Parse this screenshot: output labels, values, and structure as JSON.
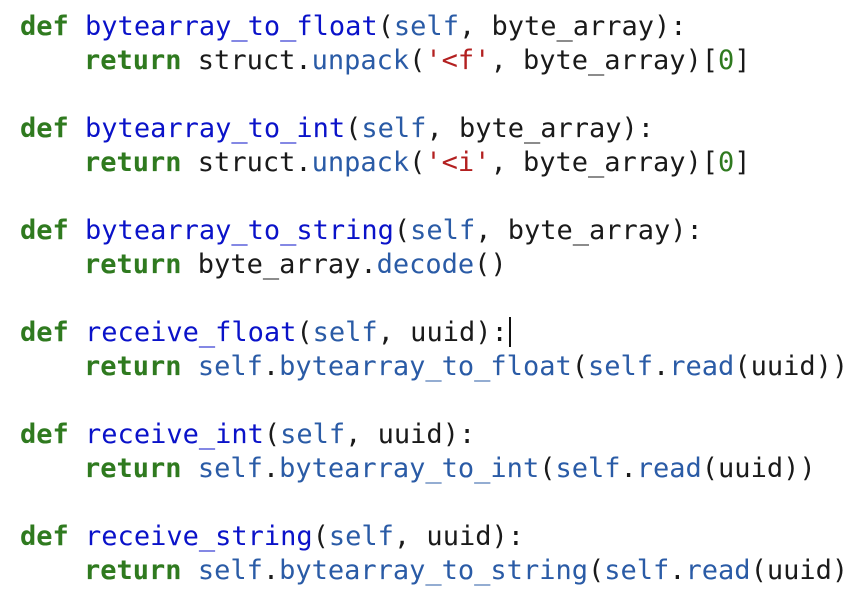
{
  "code": {
    "lines": [
      [
        {
          "t": "def",
          "c": "kw"
        },
        {
          "t": " ",
          "c": "plain"
        },
        {
          "t": "bytearray_to_float",
          "c": "fn"
        },
        {
          "t": "(",
          "c": "plain"
        },
        {
          "t": "self",
          "c": "self"
        },
        {
          "t": ", byte_array):",
          "c": "plain"
        }
      ],
      [
        {
          "t": "return",
          "c": "kw"
        },
        {
          "t": " struct.",
          "c": "plain"
        },
        {
          "t": "unpack",
          "c": "meth"
        },
        {
          "t": "(",
          "c": "plain"
        },
        {
          "t": "'<f'",
          "c": "str"
        },
        {
          "t": ", byte_array)[",
          "c": "plain"
        },
        {
          "t": "0",
          "c": "num"
        },
        {
          "t": "]",
          "c": "plain"
        }
      ],
      [],
      [
        {
          "t": "def",
          "c": "kw"
        },
        {
          "t": " ",
          "c": "plain"
        },
        {
          "t": "bytearray_to_int",
          "c": "fn"
        },
        {
          "t": "(",
          "c": "plain"
        },
        {
          "t": "self",
          "c": "self"
        },
        {
          "t": ", byte_array):",
          "c": "plain"
        }
      ],
      [
        {
          "t": "return",
          "c": "kw"
        },
        {
          "t": " struct.",
          "c": "plain"
        },
        {
          "t": "unpack",
          "c": "meth"
        },
        {
          "t": "(",
          "c": "plain"
        },
        {
          "t": "'<i'",
          "c": "str"
        },
        {
          "t": ", byte_array)[",
          "c": "plain"
        },
        {
          "t": "0",
          "c": "num"
        },
        {
          "t": "]",
          "c": "plain"
        }
      ],
      [],
      [
        {
          "t": "def",
          "c": "kw"
        },
        {
          "t": " ",
          "c": "plain"
        },
        {
          "t": "bytearray_to_string",
          "c": "fn"
        },
        {
          "t": "(",
          "c": "plain"
        },
        {
          "t": "self",
          "c": "self"
        },
        {
          "t": ", byte_array):",
          "c": "plain"
        }
      ],
      [
        {
          "t": "return",
          "c": "kw"
        },
        {
          "t": " byte_array.",
          "c": "plain"
        },
        {
          "t": "decode",
          "c": "meth"
        },
        {
          "t": "()",
          "c": "plain"
        }
      ],
      [],
      [
        {
          "t": "def",
          "c": "kw"
        },
        {
          "t": " ",
          "c": "plain"
        },
        {
          "t": "receive_float",
          "c": "fn"
        },
        {
          "t": "(",
          "c": "plain"
        },
        {
          "t": "self",
          "c": "self"
        },
        {
          "t": ", uuid):",
          "c": "plain"
        }
      ],
      [
        {
          "t": "return",
          "c": "kw"
        },
        {
          "t": " ",
          "c": "plain"
        },
        {
          "t": "self",
          "c": "self"
        },
        {
          "t": ".",
          "c": "plain"
        },
        {
          "t": "bytearray_to_float",
          "c": "meth"
        },
        {
          "t": "(",
          "c": "plain"
        },
        {
          "t": "self",
          "c": "self"
        },
        {
          "t": ".",
          "c": "plain"
        },
        {
          "t": "read",
          "c": "meth"
        },
        {
          "t": "(uuid))",
          "c": "plain"
        }
      ],
      [],
      [
        {
          "t": "def",
          "c": "kw"
        },
        {
          "t": " ",
          "c": "plain"
        },
        {
          "t": "receive_int",
          "c": "fn"
        },
        {
          "t": "(",
          "c": "plain"
        },
        {
          "t": "self",
          "c": "self"
        },
        {
          "t": ", uuid):",
          "c": "plain"
        }
      ],
      [
        {
          "t": "return",
          "c": "kw"
        },
        {
          "t": " ",
          "c": "plain"
        },
        {
          "t": "self",
          "c": "self"
        },
        {
          "t": ".",
          "c": "plain"
        },
        {
          "t": "bytearray_to_int",
          "c": "meth"
        },
        {
          "t": "(",
          "c": "plain"
        },
        {
          "t": "self",
          "c": "self"
        },
        {
          "t": ".",
          "c": "plain"
        },
        {
          "t": "read",
          "c": "meth"
        },
        {
          "t": "(uuid))",
          "c": "plain"
        }
      ],
      [],
      [
        {
          "t": "def",
          "c": "kw"
        },
        {
          "t": " ",
          "c": "plain"
        },
        {
          "t": "receive_string",
          "c": "fn"
        },
        {
          "t": "(",
          "c": "plain"
        },
        {
          "t": "self",
          "c": "self"
        },
        {
          "t": ", uuid):",
          "c": "plain"
        }
      ],
      [
        {
          "t": "return",
          "c": "kw"
        },
        {
          "t": " ",
          "c": "plain"
        },
        {
          "t": "self",
          "c": "self"
        },
        {
          "t": ".",
          "c": "plain"
        },
        {
          "t": "bytearray_to_string",
          "c": "meth"
        },
        {
          "t": "(",
          "c": "plain"
        },
        {
          "t": "self",
          "c": "self"
        },
        {
          "t": ".",
          "c": "plain"
        },
        {
          "t": "read",
          "c": "meth"
        },
        {
          "t": "(uuid))",
          "c": "plain"
        }
      ]
    ],
    "indented_lines": [
      1,
      4,
      7,
      10,
      13,
      16
    ],
    "caret_line": 9
  },
  "colors": {
    "keyword": "#2f7a1f",
    "function_name": "#0a12c9",
    "self": "#2a5ba6",
    "method": "#2a5ba6",
    "string": "#b32020",
    "number": "#2f7a1f",
    "text": "#1a1a1a",
    "background": "#ffffff"
  }
}
